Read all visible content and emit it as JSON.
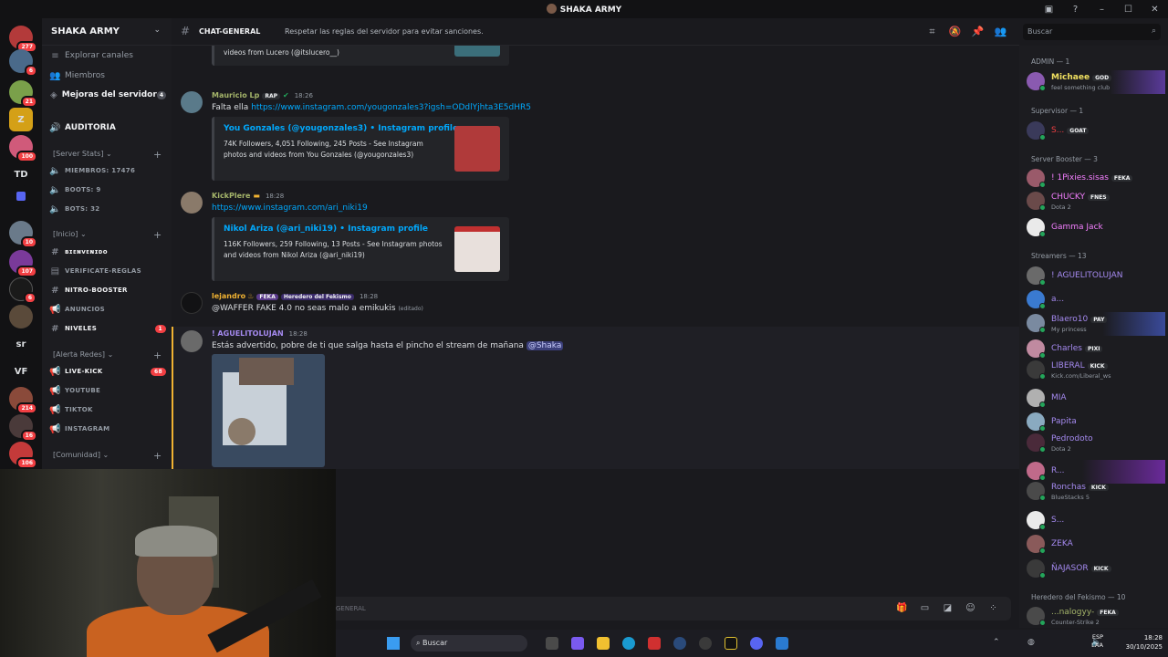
{
  "window": {
    "title": "SHAKA ARMY"
  },
  "server": {
    "name": "SHAKA ARMY"
  },
  "guild_badges": [
    "277",
    "6",
    "21",
    "100",
    "10",
    "107",
    "6",
    "214",
    "16",
    "106"
  ],
  "guild_texts": [
    "TD",
    "sr",
    "VF"
  ],
  "nav": {
    "explore": "Explorar canales",
    "members": "Miembros",
    "boosts": "Mejoras del servidor",
    "boosts_count": "4"
  },
  "channels": {
    "auditoria": "AUDITORIA",
    "cat_stats": "[Server Stats]",
    "miembros": "MIEMBROS: 17476",
    "boots": "BOOTS: 9",
    "bots": "BOTS: 32",
    "cat_inicio": "[Inicio]",
    "bienvenido": "ʙɪᴇɴᴠᴇɴɪᴅᴏ",
    "verificate": "VERIFICATE-REGLAS",
    "nitro": "NITRO-BOOSTER",
    "anuncios": "ANUNCIOS",
    "niveles": "NIVELES",
    "niveles_badge": "1",
    "cat_alerta": "[Alerta Redes]",
    "livekick": "LIVE-KICK",
    "livekick_badge": "68",
    "youtube": "YOUTUBE",
    "tiktok": "TIKTOK",
    "instagram": "INSTAGRAM",
    "cat_comunidad": "[Comunidad]"
  },
  "header": {
    "channel": "CHAT-GENERAL",
    "topic": "Respetar las reglas del servidor para evitar sanciones."
  },
  "search": {
    "placeholder": "Buscar"
  },
  "messages": {
    "m0": {
      "embed_desc": "videos from Lucero (@itslucero__)"
    },
    "m1": {
      "user": "Mauricio Lp",
      "tag": "RAP",
      "time": "18:26",
      "text": "Falta ella",
      "link": "https://www.instagram.com/yougonzales3?igsh=ODdlYjhta3E5dHR5",
      "embed_title": "You Gonzales (@yougonzales3) • Instagram profile",
      "embed_desc": "74K Followers, 4,051 Following, 245 Posts - See Instagram photos and videos from You Gonzales (@yougonzales3)"
    },
    "m2": {
      "user": "KickPlere",
      "time": "18:28",
      "link": "https://www.instagram.com/ari_niki19",
      "embed_title": "Nikol Ariza (@ari_niki19) • Instagram profile",
      "embed_desc": "116K Followers, 259 Following, 13 Posts - See Instagram photos and videos from Nikol Ariza (@ari_niki19)"
    },
    "m3": {
      "user": "lejandro",
      "tag1": "FEKA",
      "tag2": "Heredero del Fekismo",
      "time": "18:28",
      "text": "@WAFFER FAKE 4.0 no seas malo a emikukis",
      "edited": "(editado)"
    },
    "m4": {
      "user": "! AGUELITOLUJAN",
      "time": "18:28",
      "text": "Estás advertido, pobre de ti que salga hasta el pincho el stream de mañana",
      "mention": "@Shaka"
    }
  },
  "composer": {
    "placeholder": "GENERAL"
  },
  "members": {
    "cat_admin": "ADMIN — 1",
    "admin": [
      {
        "name": "Michaee",
        "tag": "GOD",
        "status": "feel something club"
      }
    ],
    "cat_supervisor": "Supervisor — 1",
    "supervisor": [
      {
        "name": "S...",
        "tag": "GOAT"
      }
    ],
    "cat_booster": "Server Booster — 3",
    "booster": [
      {
        "name": "! 1Pixies.sisas",
        "tag": "FEKA"
      },
      {
        "name": "CHUCKY",
        "tag": "FNES",
        "status": "Dota 2"
      },
      {
        "name": "Gamma Jack"
      }
    ],
    "cat_streamers": "Streamers — 13",
    "streamers": [
      {
        "name": "! AGUELITOLUJAN"
      },
      {
        "name": "a..."
      },
      {
        "name": "Blaero10",
        "tag": "PAY",
        "status": "My princess"
      },
      {
        "name": "Charles",
        "tag": "PIXI"
      },
      {
        "name": "LIBERAL",
        "tag": "KICK",
        "status": "Kick.com/Liberal_ws"
      },
      {
        "name": "MIA"
      },
      {
        "name": "Papita"
      },
      {
        "name": "Pedrodoto",
        "status": "Dota 2"
      },
      {
        "name": "R..."
      },
      {
        "name": "Ronchas",
        "tag": "KICK",
        "status": "BlueStacks 5"
      },
      {
        "name": "S..."
      },
      {
        "name": "ZEKA"
      },
      {
        "name": "ÑAJASOR",
        "tag": "KICK"
      }
    ],
    "cat_heredero": "Heredero del Fekismo — 10",
    "heredero": [
      {
        "name": "...nalogyy-",
        "tag": "FEKA",
        "status": "Counter-Strike 2"
      }
    ]
  },
  "taskbar": {
    "search": "Buscar",
    "lang1": "ESP",
    "lang2": "LAA",
    "time": "18:28",
    "date": "30/10/2025"
  }
}
